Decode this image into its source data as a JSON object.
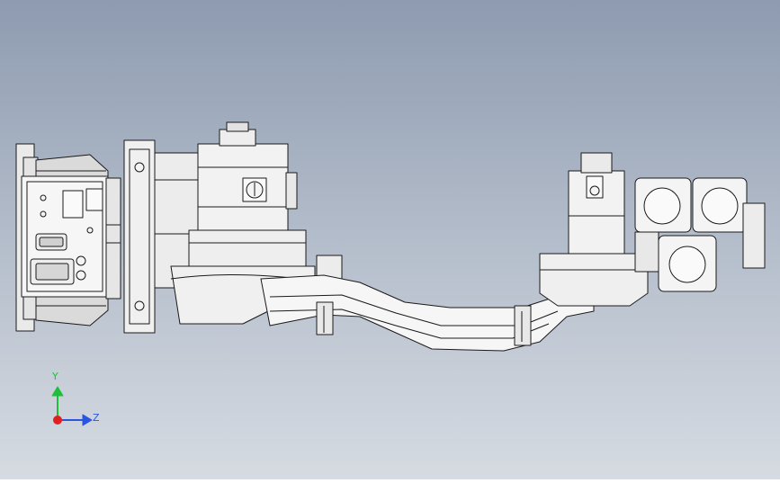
{
  "viewport": {
    "background_top": "#8e9bb0",
    "background_bottom": "#d6dbe2",
    "model_stroke": "#1a1a1a",
    "model_fill": "#f4f4f4"
  },
  "triad": {
    "y_label": "Y",
    "z_label": "Z",
    "y_color": "#1fbf3a",
    "z_color": "#2a55e0",
    "x_color": "#e02020"
  }
}
